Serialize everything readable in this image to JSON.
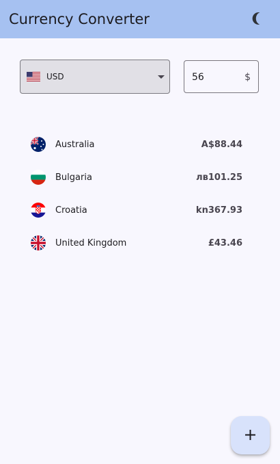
{
  "app_bar": {
    "title": "Currency Converter",
    "theme_icon": "moon-icon",
    "background": "#a6c1f1"
  },
  "converter": {
    "selected_currency": "USD",
    "selected_flag": "us-flag-icon",
    "amount": "56",
    "amount_suffix": "$"
  },
  "rates": [
    {
      "country": "Australia",
      "value": "A$88.44",
      "flag": "australia-flag-icon"
    },
    {
      "country": "Bulgaria",
      "value": "лв101.25",
      "flag": "bulgaria-flag-icon"
    },
    {
      "country": "Croatia",
      "value": "kn367.93",
      "flag": "croatia-flag-icon"
    },
    {
      "country": "United Kingdom",
      "value": "£43.46",
      "flag": "uk-flag-icon"
    }
  ],
  "fab": {
    "icon": "plus-icon"
  },
  "colors": {
    "background": "#f8f7fe",
    "fab": "#d8e2fb",
    "select_fill": "#e1e0e6"
  }
}
